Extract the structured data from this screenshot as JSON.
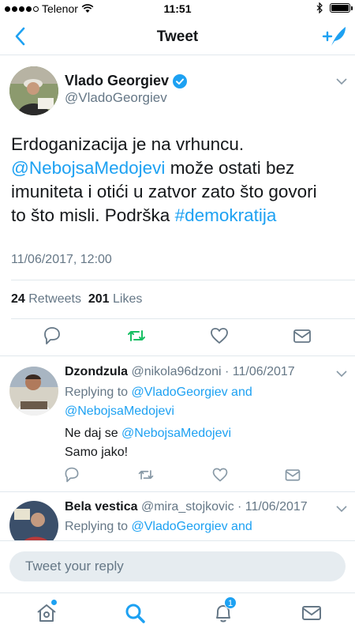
{
  "status_bar": {
    "carrier": "Telenor",
    "time": "11:51"
  },
  "nav": {
    "title": "Tweet"
  },
  "tweet": {
    "author_name": "Vlado Georgiev",
    "author_handle": "@VladoGeorgiev",
    "text_1": "Erdoganizacija je na vrhuncu.",
    "mention": "@NebojsaMedojevi",
    "text_2": " može ostati bez",
    "text_3": "imuniteta i otići u zatvor zato što govori",
    "text_4": "to što misli. Podrška ",
    "hashtag": "#demokratija",
    "date": "11/06/2017, 12:00",
    "retweets_count": "24",
    "retweets_label": "Retweets",
    "likes_count": "201",
    "likes_label": "Likes"
  },
  "replies": [
    {
      "name": "Dzondzula",
      "handle_date": "@nikola96dzoni · 11/06/2017",
      "replying_label": "Replying to ",
      "replying_to_1": "@VladoGeorgiev",
      "replying_and": " and",
      "replying_to_2": "@NebojsaMedojevi",
      "text_1_prefix": "Ne daj se ",
      "text_1_mention": "@NebojsaMedojevi",
      "text_2": "Samo jako!"
    },
    {
      "name": "Bela vestica",
      "handle_date": "@mira_stojkovic · 11/06/2017",
      "replying_label": "Replying to ",
      "replying_to_1": "@VladoGeorgiev",
      "replying_and": " and"
    }
  ],
  "reply_input": {
    "placeholder": "Tweet your reply"
  },
  "tab_bar": {
    "notifications_badge": "1"
  },
  "colors": {
    "accent": "#1da1f2",
    "retweet_green": "#17bf63",
    "secondary_text": "#657786"
  }
}
